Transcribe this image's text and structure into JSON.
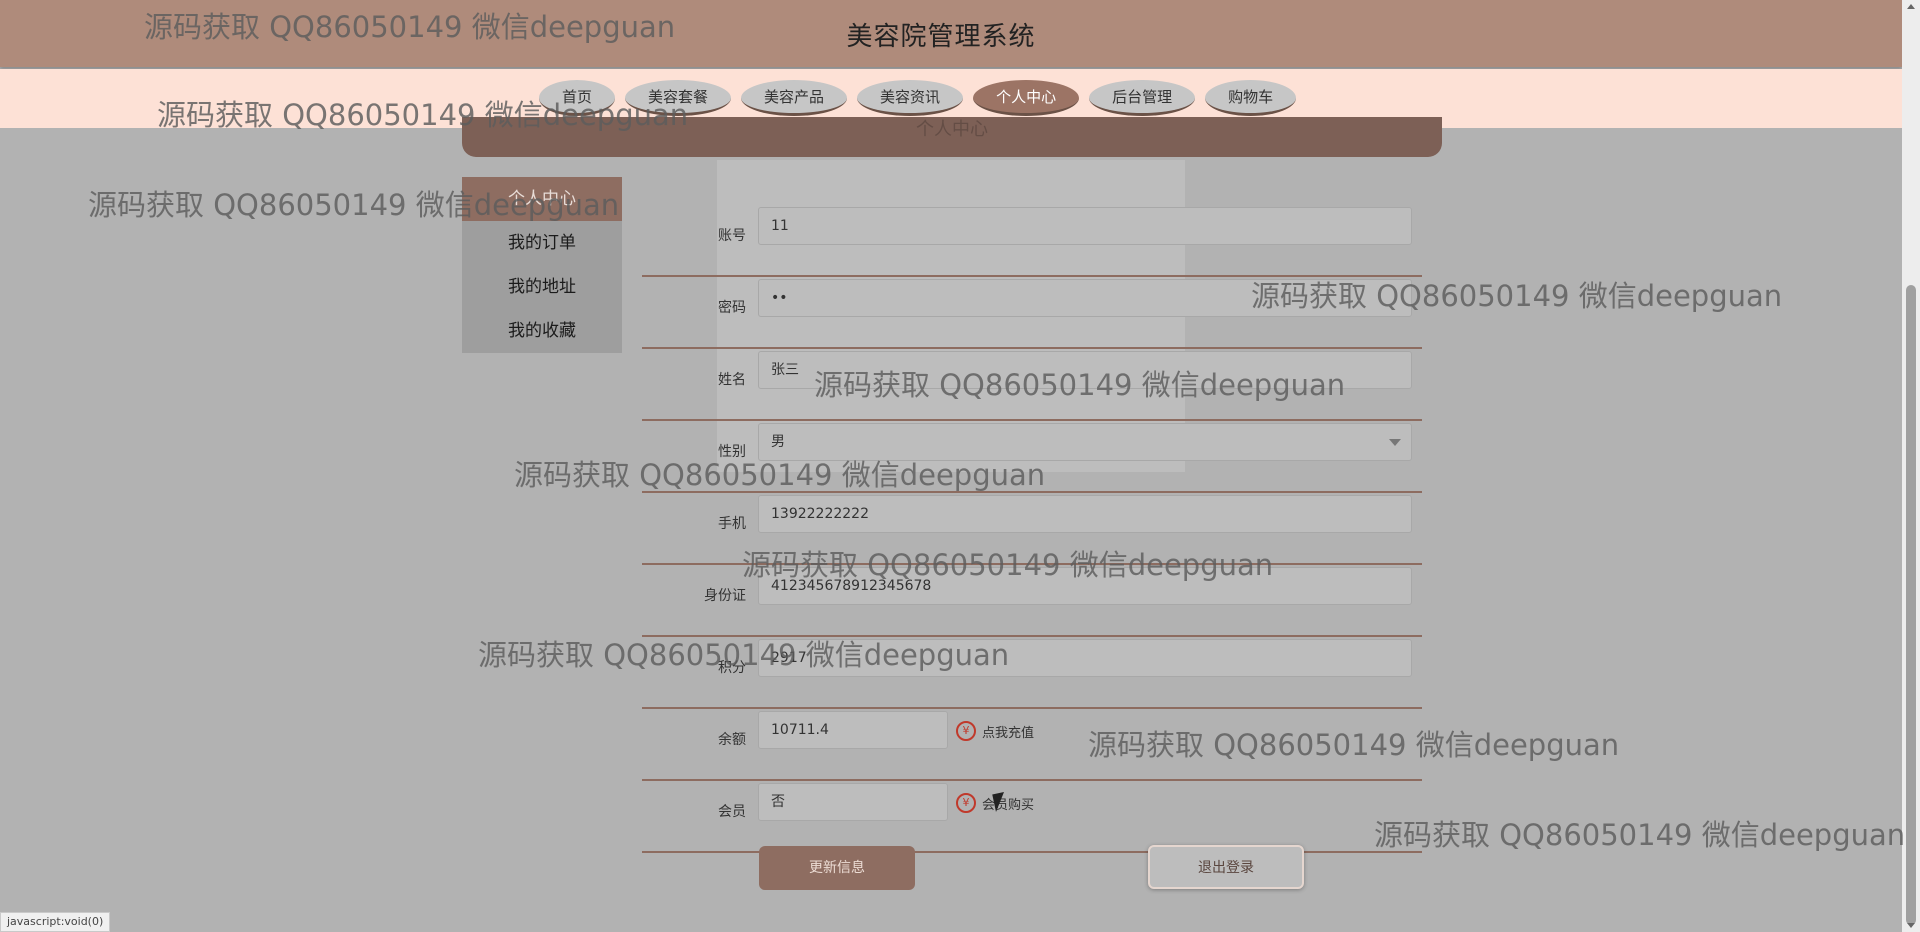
{
  "site_title": "美容院管理系统",
  "nav": {
    "items": [
      {
        "label": "首页"
      },
      {
        "label": "美容套餐"
      },
      {
        "label": "美容产品"
      },
      {
        "label": "美容资讯"
      },
      {
        "label": "个人中心"
      },
      {
        "label": "后台管理"
      },
      {
        "label": "购物车"
      }
    ],
    "active_index": 4
  },
  "section_title": "个人中心",
  "side_menu": {
    "items": [
      {
        "label": "个人中心"
      },
      {
        "label": "我的订单"
      },
      {
        "label": "我的地址"
      },
      {
        "label": "我的收藏"
      }
    ]
  },
  "form": {
    "fields": [
      {
        "label": "账号",
        "value": "11"
      },
      {
        "label": "密码",
        "value": "••"
      },
      {
        "label": "姓名",
        "value": "张三"
      },
      {
        "label": "性别",
        "value": "男"
      },
      {
        "label": "手机",
        "value": "13922222222"
      },
      {
        "label": "身份证",
        "value": "412345678912345678"
      },
      {
        "label": "积分",
        "value": "2917"
      },
      {
        "label": "余额",
        "value": "10711.4",
        "action": "点我充值"
      },
      {
        "label": "会员",
        "value": "否",
        "action": "会员购买"
      }
    ],
    "yen_symbol": "¥",
    "update_label": "更新信息",
    "logout_label": "退出登录"
  },
  "status_bar": "javascript:void(0)",
  "watermark_text": "源码获取 QQ86050149 微信deepguan",
  "colors": {
    "header": "#af8b7b",
    "nav_band": "#fde1d6",
    "accent": "#8e6d61",
    "overlay_bg": "#b2b2b2"
  }
}
